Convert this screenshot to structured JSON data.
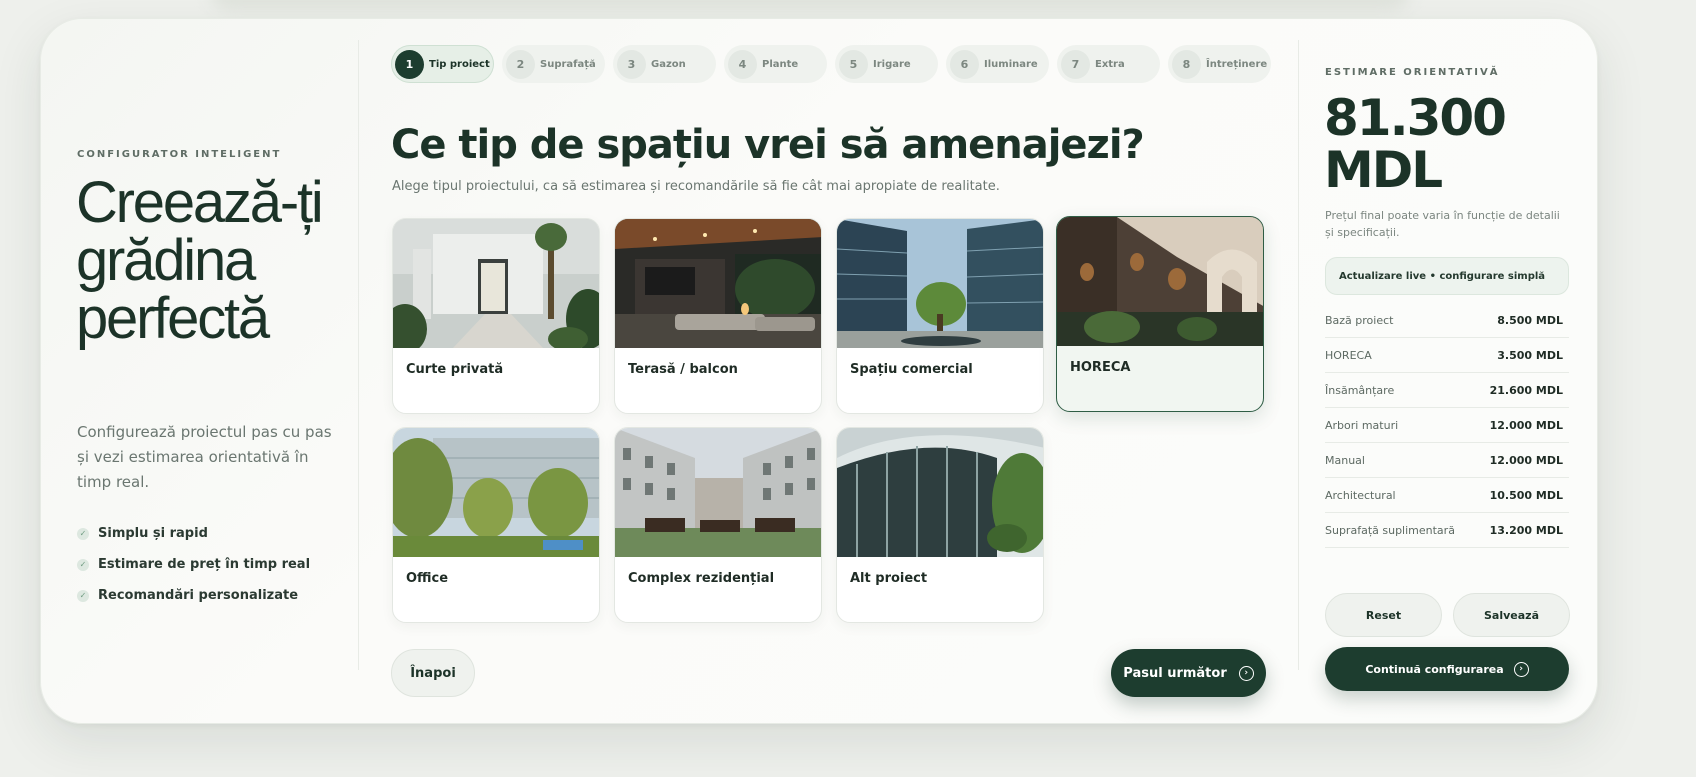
{
  "hero": {
    "eyebrow": "CONFIGURATOR INTELIGENT",
    "title": "Creează-ți grădina perfectă",
    "subtitle": "Configurează proiectul pas cu pas și vezi estimarea orientativă în timp real.",
    "features": [
      "Simplu și rapid",
      "Estimare de preț în timp real",
      "Recomandări personalizate"
    ],
    "feature_icon": "check-icon"
  },
  "steps": [
    {
      "num": "1",
      "label": "Tip proiect",
      "active": true
    },
    {
      "num": "2",
      "label": "Suprafață",
      "active": false
    },
    {
      "num": "3",
      "label": "Gazon",
      "active": false
    },
    {
      "num": "4",
      "label": "Plante",
      "active": false
    },
    {
      "num": "5",
      "label": "Irigare",
      "active": false
    },
    {
      "num": "6",
      "label": "Iluminare",
      "active": false
    },
    {
      "num": "7",
      "label": "Extra",
      "active": false
    },
    {
      "num": "8",
      "label": "Întreținere",
      "active": false
    }
  ],
  "main": {
    "title": "Ce tip de spațiu vrei să amenajezi?",
    "subtitle": "Alege tipul proiectului, ca să estimarea și recomandările să fie cât mai apropiate de realitate.",
    "options": [
      {
        "label": "Curte privată",
        "selected": false
      },
      {
        "label": "Terasă / balcon",
        "selected": false
      },
      {
        "label": "Spațiu comercial",
        "selected": false
      },
      {
        "label": "HORECA",
        "selected": true
      },
      {
        "label": "Office",
        "selected": false
      },
      {
        "label": "Complex rezidențial",
        "selected": false
      },
      {
        "label": "Alt proiect",
        "selected": false
      }
    ],
    "back_label": "Înapoi",
    "next_label": "Pasul următor",
    "next_icon": "arrow-right-circle-icon"
  },
  "estimate": {
    "eyebrow": "ESTIMARE ORIENTATIVĂ",
    "value": "81.300 MDL",
    "note": "Prețul final poate varia în funcție de detalii și specificații.",
    "live": "Actualizare live • configurare simplă",
    "items": [
      {
        "label": "Bază proiect",
        "value": "8.500 MDL"
      },
      {
        "label": "HORECA",
        "value": "3.500 MDL"
      },
      {
        "label": "Însămânțare",
        "value": "21.600 MDL"
      },
      {
        "label": "Arbori maturi",
        "value": "12.000 MDL"
      },
      {
        "label": "Manual",
        "value": "12.000 MDL"
      },
      {
        "label": "Architectural",
        "value": "10.500 MDL"
      },
      {
        "label": "Suprafață suplimentară",
        "value": "13.200 MDL"
      }
    ],
    "reset_label": "Reset",
    "save_label": "Salvează",
    "continue_label": "Continuă configurarea"
  },
  "colors": {
    "accent": "#1d3d2f",
    "background": "#eef0ec",
    "card": "#fbfbf9"
  }
}
